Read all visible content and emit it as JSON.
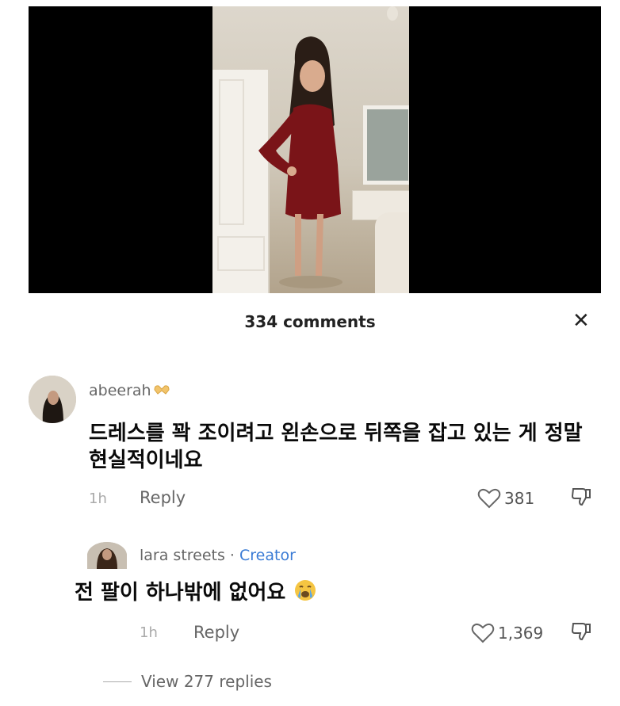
{
  "header": {
    "comments_count": "334 comments"
  },
  "comments": [
    {
      "username": "abeerah",
      "text": "드레스를 꽉 조이려고 왼손으로 뒤쪽을 잡고 있는 게 정말 현실적이네요",
      "time": "1h",
      "reply_label": "Reply",
      "likes": "381"
    },
    {
      "username": "lara streets",
      "separator": " · ",
      "badge": "Creator",
      "text": "전 팔이 하나밖에 없어요",
      "time": "1h",
      "reply_label": "Reply",
      "likes": "1,369"
    }
  ],
  "view_replies_label": "View 277 replies",
  "icons": {
    "close": "close-icon",
    "heart": "heart-icon",
    "dislike": "thumbs-down-icon",
    "emoji": "crying-face-emoji",
    "username_emoji": "heart-hands-emoji"
  },
  "colors": {
    "creator": "#3a7bd5",
    "background": "#ffffff",
    "text": "#0a0a0a"
  }
}
